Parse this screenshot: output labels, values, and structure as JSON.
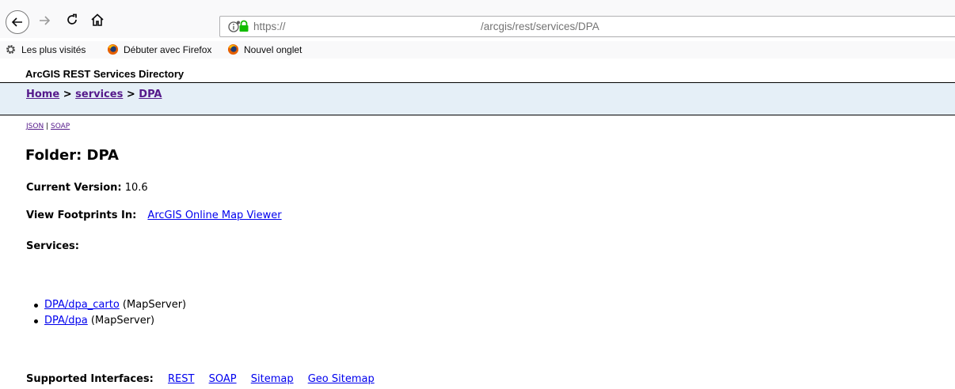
{
  "browser": {
    "url_scheme": "https://",
    "url_path": "/arcgis/rest/services/DPA",
    "bookmarks": [
      "Les plus visités",
      "Débuter avec Firefox",
      "Nouvel onglet"
    ]
  },
  "page": {
    "directory_title": "ArcGIS REST Services Directory",
    "breadcrumb": {
      "home": "Home",
      "services": "services",
      "current": "DPA",
      "separator": ">"
    },
    "formats": {
      "json": "JSON",
      "separator": "|",
      "soap": "SOAP"
    },
    "folder_heading": "Folder: DPA",
    "current_version_label": "Current Version:",
    "current_version_value": "10.6",
    "footprints_label": "View Footprints In:",
    "footprints_link": "ArcGIS Online Map Viewer",
    "services_label": "Services:",
    "services": [
      {
        "name": "DPA/dpa_carto",
        "type": "(MapServer)"
      },
      {
        "name": "DPA/dpa",
        "type": "(MapServer)"
      }
    ],
    "interfaces_label": "Supported Interfaces:",
    "interfaces": [
      "REST",
      "SOAP",
      "Sitemap",
      "Geo Sitemap"
    ]
  },
  "colors": {
    "breadcrumb_bg": "#e5eff7",
    "visited_link": "#551a8b",
    "link": "#0000ee",
    "lock_green": "#12bc00"
  }
}
